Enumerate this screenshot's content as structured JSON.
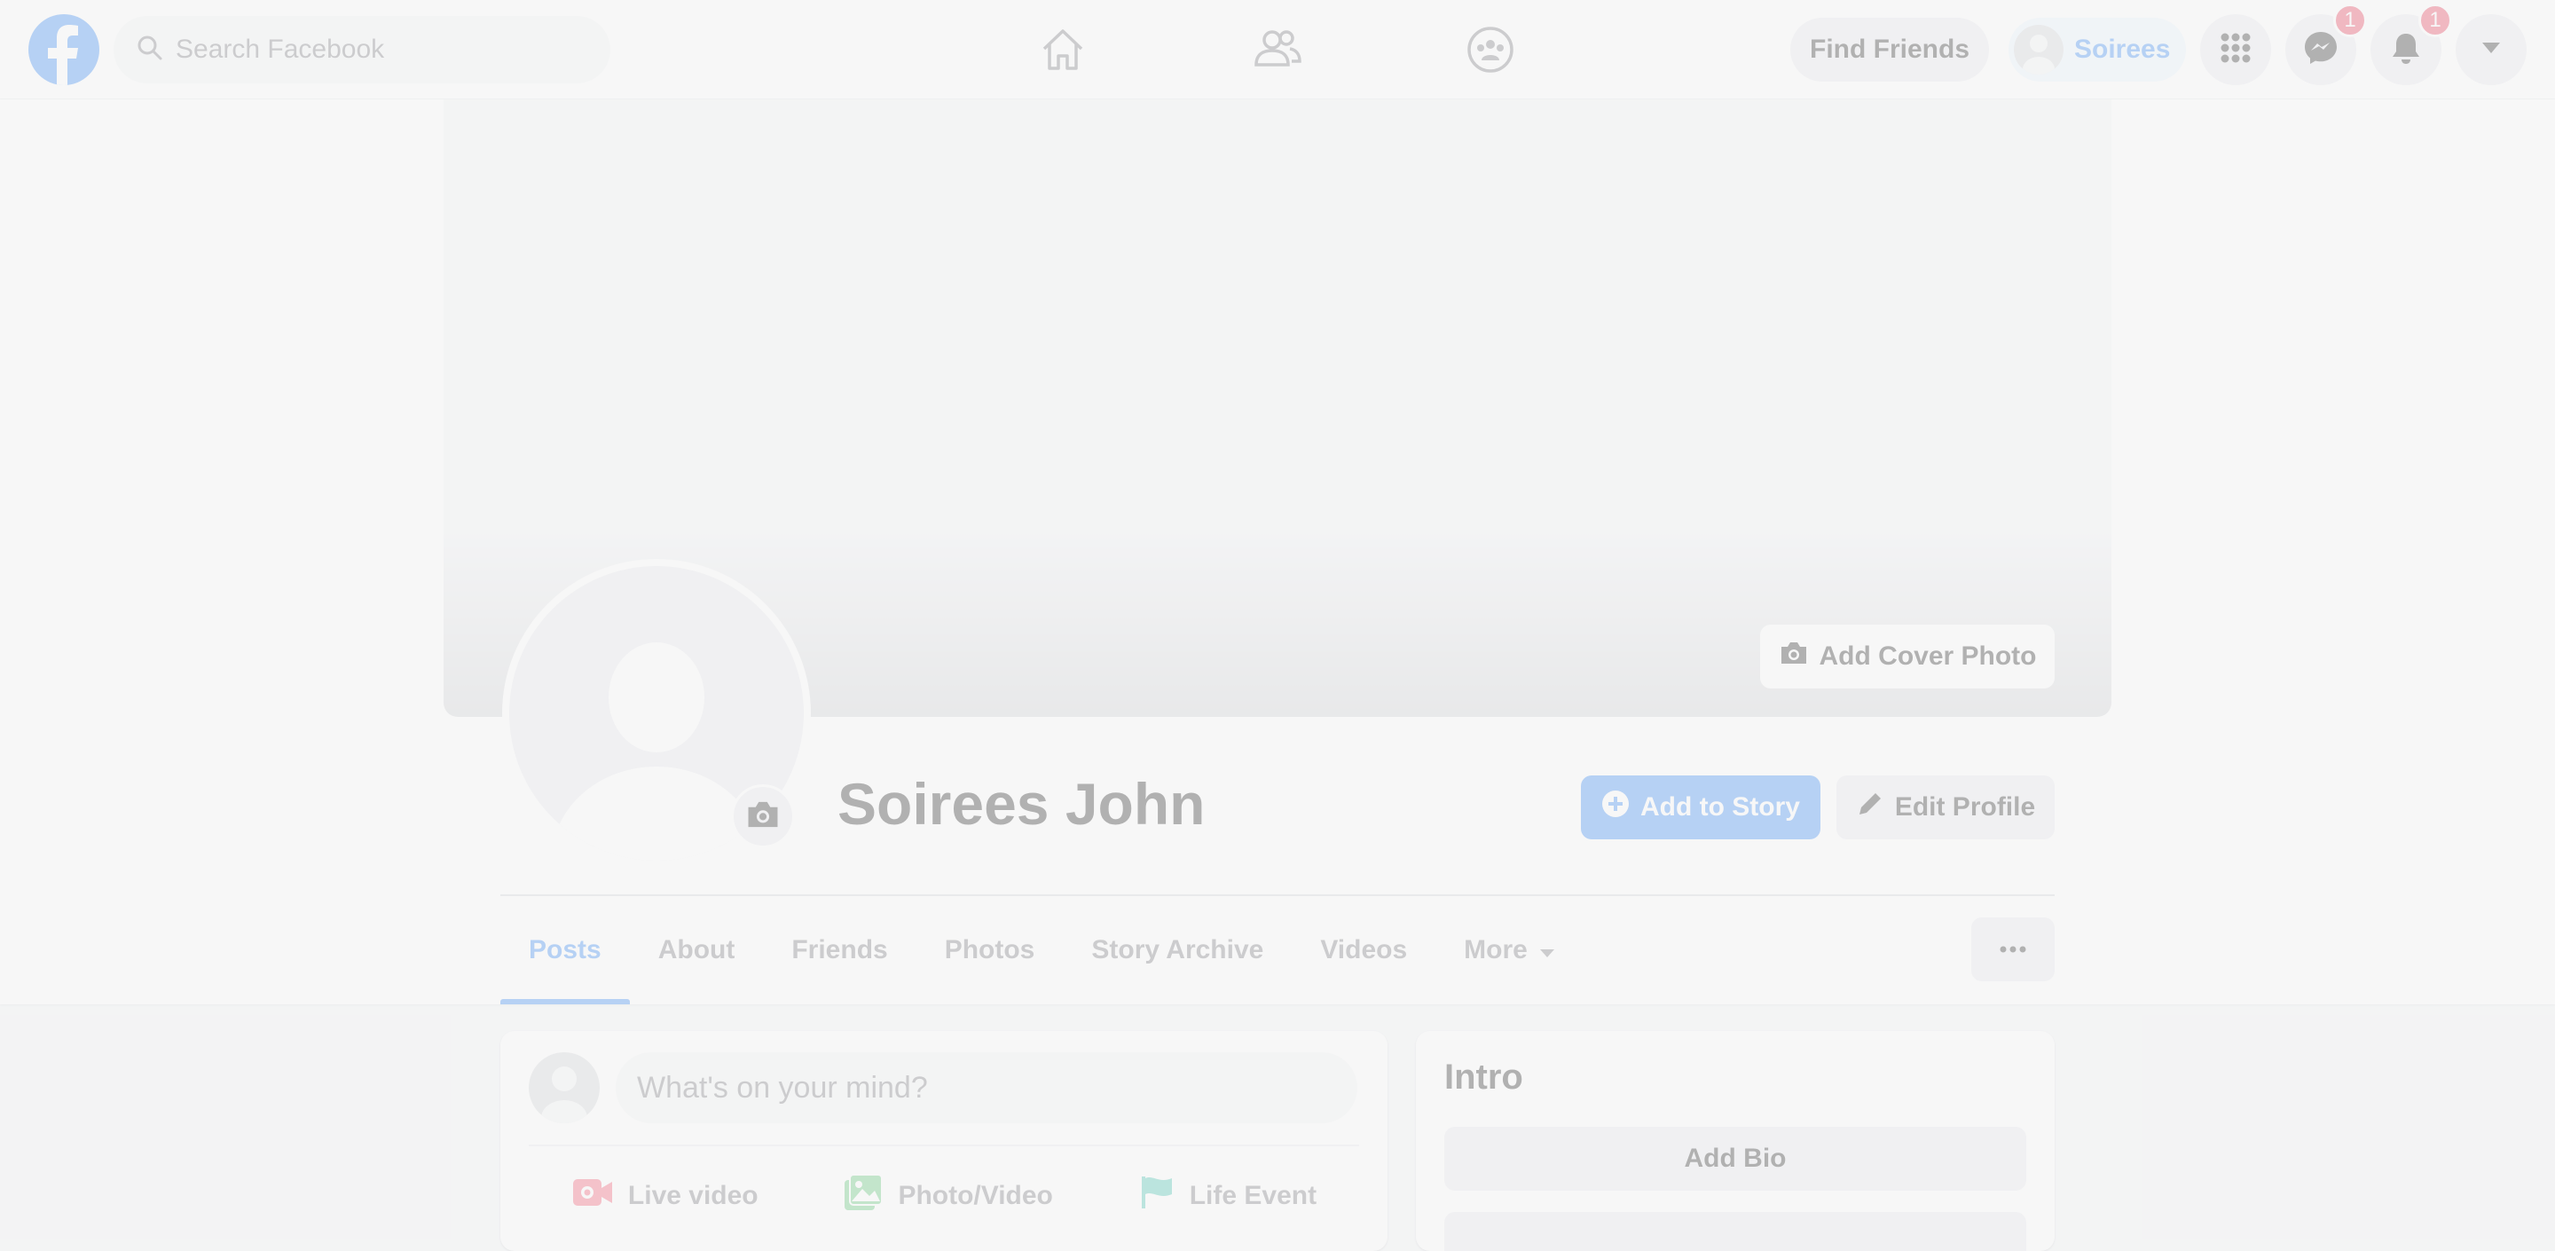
{
  "topbar": {
    "search_placeholder": "Search Facebook",
    "find_friends_label": "Find Friends",
    "profile_chip_name": "Soirees",
    "messenger_badge": "1",
    "notifications_badge": "1"
  },
  "profile": {
    "name": "Soirees John",
    "add_cover_label": "Add Cover Photo",
    "add_story_label": "Add to Story",
    "edit_profile_label": "Edit Profile"
  },
  "tabs": [
    {
      "label": "Posts",
      "active": true
    },
    {
      "label": "About"
    },
    {
      "label": "Friends"
    },
    {
      "label": "Photos"
    },
    {
      "label": "Story Archive"
    },
    {
      "label": "Videos"
    },
    {
      "label": "More"
    }
  ],
  "composer": {
    "placeholder": "What's on your mind?",
    "actions": [
      {
        "label": "Live video",
        "icon": "live-video-icon"
      },
      {
        "label": "Photo/Video",
        "icon": "photo-icon"
      },
      {
        "label": "Life Event",
        "icon": "flag-icon"
      }
    ]
  },
  "intro": {
    "title": "Intro",
    "add_bio_label": "Add Bio"
  },
  "colors": {
    "brand": "#1877f2",
    "badge": "#e41e3f",
    "live": "#f3425f",
    "photo": "#45bd62",
    "life_event": "#2abba7"
  }
}
